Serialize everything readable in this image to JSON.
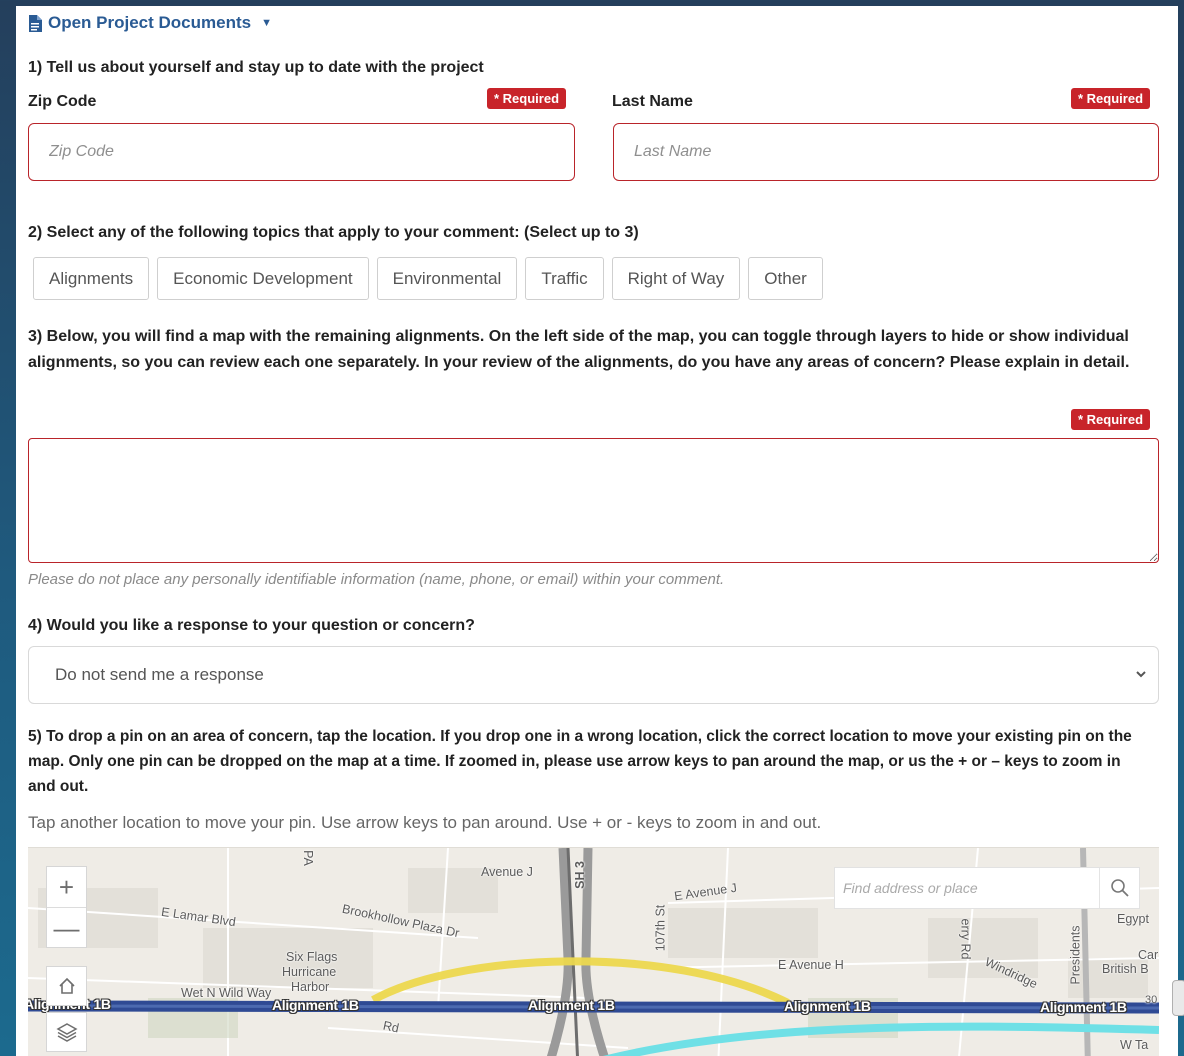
{
  "header": {
    "docs_label": "Open Project Documents"
  },
  "section1": {
    "title": "1) Tell us about yourself and stay up to date with the project",
    "zip": {
      "label": "Zip Code",
      "placeholder": "Zip Code",
      "required": "* Required",
      "value": ""
    },
    "last_name": {
      "label": "Last Name",
      "placeholder": "Last Name",
      "required": "* Required",
      "value": ""
    }
  },
  "section2": {
    "title": "2) Select any of the following topics that apply to your comment: (Select up to 3)",
    "topics": [
      "Alignments",
      "Economic Development",
      "Environmental",
      "Traffic",
      "Right of Way",
      "Other"
    ]
  },
  "section3": {
    "text": "3) Below, you will find a map with the remaining alignments. On the left side of the map, you can toggle through layers to hide or show individual alignments, so you can review each one separately. In your review of the alignments, do you have any areas of concern? Please explain in detail.",
    "required": "* Required",
    "comment_value": "",
    "hint": "Please do not place any personally identifiable information (name, phone, or email) within your comment."
  },
  "section4": {
    "title": "4) Would you like a response to your question or concern?",
    "selected": "Do not send me a response"
  },
  "section5": {
    "text": "5) To drop a pin on an area of concern, tap the location. If you drop one in a wrong location, click the correct location to move your existing pin on the map. Only one pin can be dropped on the map at a time. If zoomed in, please use arrow keys to pan around the map, or us the + or – keys to zoom in and out.",
    "instruction": "Tap another location to move your pin. Use arrow keys to pan around. Use + or - keys to zoom in and out."
  },
  "map": {
    "zoom_in": "+",
    "zoom_out": "—",
    "search_placeholder": "Find address or place",
    "labels": {
      "avenue_j": "Avenue J",
      "e_avenue_j": "E Avenue J",
      "e_lamar": "E Lamar Blvd",
      "brookhollow": "Brookhollow Plaza Dr",
      "six_flags": "Six Flags",
      "hurricane": "Hurricane",
      "harbor": "Harbor",
      "wet_wild": "Wet N Wild Way",
      "e_avenue_h": "E Avenue H",
      "sh3": "SH 3",
      "st107": "107th St",
      "ferry_rd": "erry Rd",
      "egypt": "Egypt",
      "car": "Car",
      "british": "British B",
      "windridge": "Windridge",
      "presidents": "Presidents",
      "rd": "Rd",
      "w_ta": "W Ta",
      "n_30": "30"
    },
    "routes": {
      "alignment_1": "Alignment 1B",
      "alignment_2": "Alignment 1B",
      "alignment_3": "Alignment 1B",
      "alignment_4": "Alignment 1B",
      "alignment_5": "Alignment 1B"
    },
    "colors": {
      "yellow": "#ecd84e",
      "blue": "#2f4a94",
      "cyan": "#6fe0e6",
      "highway": "#9a9a9a"
    }
  }
}
